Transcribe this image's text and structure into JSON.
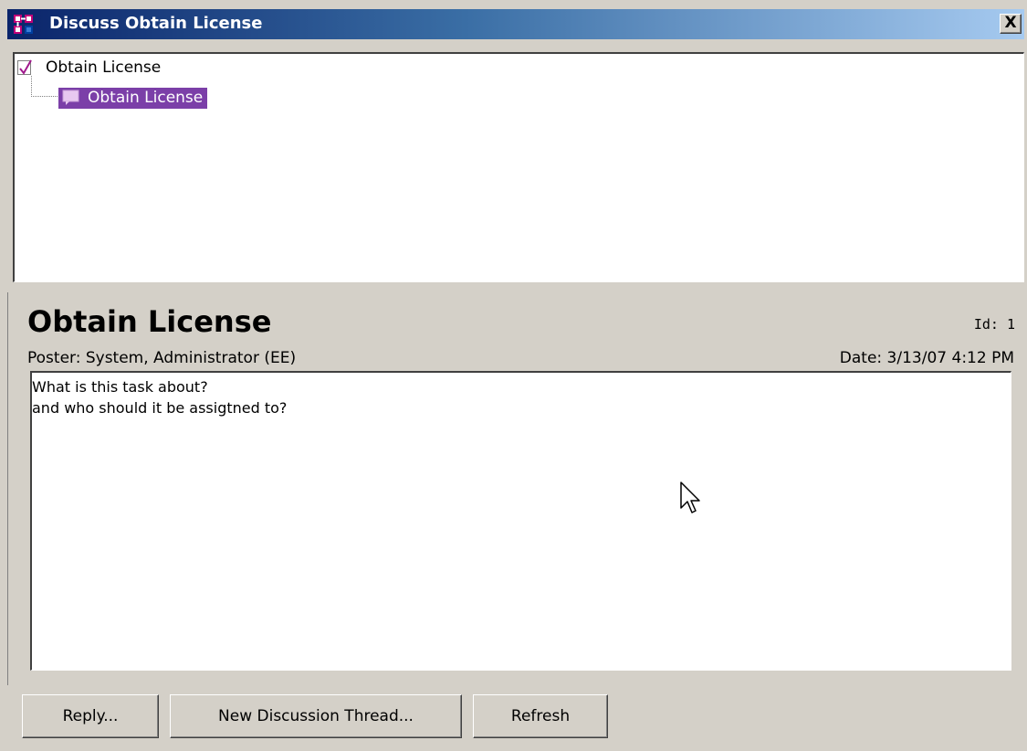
{
  "window": {
    "title": "Discuss Obtain License",
    "close_label": "X"
  },
  "tree": {
    "root_label": "Obtain License",
    "child_label": "Obtain License"
  },
  "detail": {
    "title": "Obtain License",
    "id_text": "Id: 1",
    "poster_text": "Poster: System, Administrator  (EE)",
    "date_text": "Date: 3/13/07 4:12 PM",
    "body_lines": [
      "What is this task about?",
      "and who should it be assigtned to?"
    ]
  },
  "buttons": {
    "reply": "Reply...",
    "new_thread": "New Discussion Thread...",
    "refresh": "Refresh"
  },
  "colors": {
    "title_bar": "#0a246a",
    "selection": "#7b3fa8",
    "face": "#d4d0c8"
  }
}
